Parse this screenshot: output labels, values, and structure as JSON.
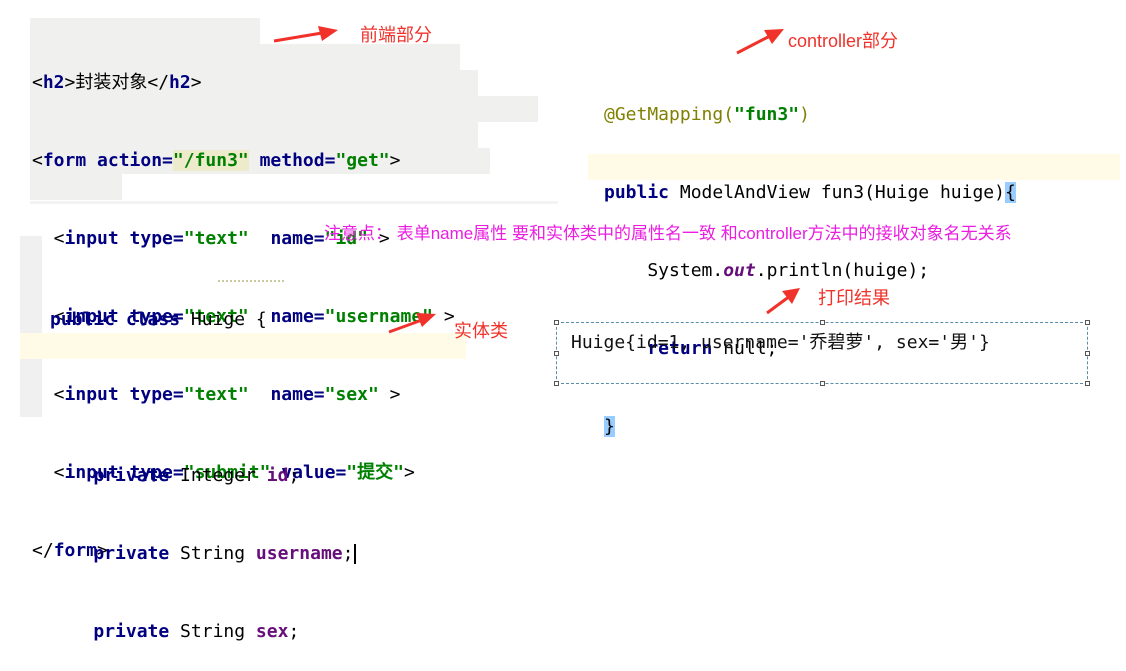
{
  "frontend": {
    "lines": [
      [
        "<",
        "h2",
        ">封装对象</",
        "h2",
        ">"
      ],
      [
        "<",
        "form ",
        "action=",
        "\"/fun3\"",
        " method=",
        "\"get\"",
        ">"
      ],
      [
        "  <",
        "input ",
        "type=",
        "\"text\"",
        "  name=",
        "\"id\"",
        " >"
      ],
      [
        "  <",
        "input ",
        "type=",
        "\"text\"",
        "  name=",
        "\"username\"",
        " >"
      ],
      [
        "  <",
        "input ",
        "type=",
        "\"text\"",
        "  name=",
        "\"sex\"",
        " >"
      ],
      [
        "  <",
        "input ",
        "type=",
        "\"submit\"",
        " value=",
        "\"提交\"",
        ">"
      ],
      [
        "</",
        "form",
        ">"
      ]
    ]
  },
  "controller": {
    "annotation": "@GetMapping(",
    "annotation_arg": "\"fun3\"",
    "annotation_close": ")",
    "sig_public": "public",
    "sig_rest": " ModelAndView fun3(Huige huige)",
    "open_brace": "{",
    "stmt1_a": "    System.",
    "stmt1_out": "out",
    "stmt1_b": ".println(huige);",
    "stmt2_return": "    return",
    "stmt2_rest": " null;",
    "close_brace": "}"
  },
  "entity": {
    "decl_kw": "public class",
    "decl_rest": " Huige {",
    "fields": [
      {
        "kw": "private",
        "type": " Integer ",
        "name": "id",
        "end": ";"
      },
      {
        "kw": "private",
        "type": " String ",
        "name": "username",
        "end": ";"
      },
      {
        "kw": "private",
        "type": " String ",
        "name": "sex",
        "end": ";"
      }
    ]
  },
  "labels": {
    "frontend": "前端部分",
    "controller": "controller部分",
    "entity": "实体类",
    "result": "打印结果"
  },
  "note": "注意点： 表单name属性 要和实体类中的属性名一致   和controller方法中的接收对象名无关系",
  "result": "Huige{id=1, username='乔碧萝', sex='男'}",
  "colors": {
    "label": "#f0322a",
    "note": "#e91ee0",
    "keyword": "#000080",
    "string": "#008000"
  }
}
